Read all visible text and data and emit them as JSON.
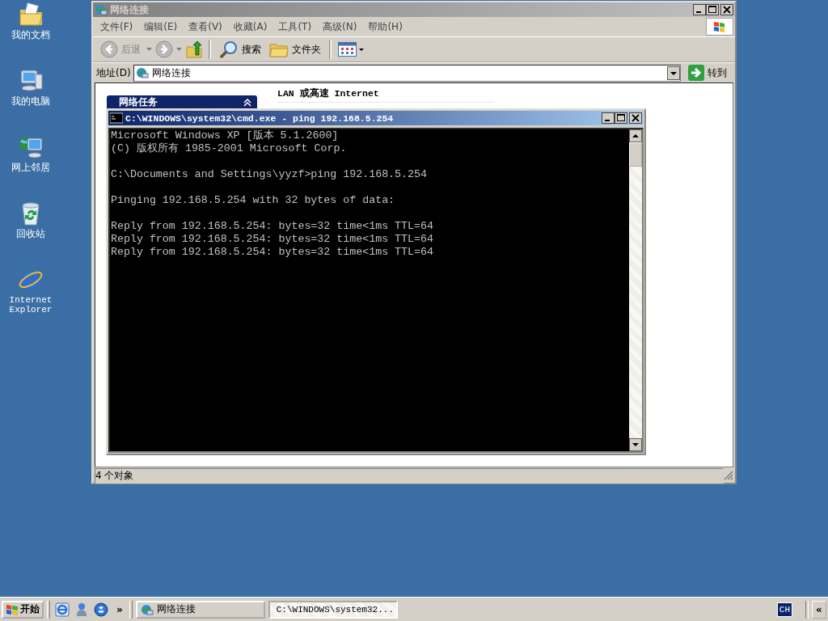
{
  "desktop_icons": [
    {
      "label": "我的文档",
      "kind": "documents"
    },
    {
      "label": "我的电脑",
      "kind": "computer"
    },
    {
      "label": "网上邻居",
      "kind": "network"
    },
    {
      "label": "回收站",
      "kind": "recycle"
    },
    {
      "label": "Internet Explorer",
      "kind": "browser"
    }
  ],
  "explorer": {
    "title": "网络连接",
    "active": false,
    "menu": [
      "文件(F)",
      "编辑(E)",
      "查看(V)",
      "收藏(A)",
      "工具(T)",
      "高级(N)",
      "帮助(H)"
    ],
    "toolbar": {
      "back": "后退",
      "search": "搜索",
      "folders": "文件夹"
    },
    "address": {
      "label": "地址(D)",
      "value": "网络连接",
      "go": "转到"
    },
    "task_panel": {
      "title": "网络任务"
    },
    "section_header": "LAN 或高速 Internet",
    "status_bar": "4 个对象"
  },
  "console": {
    "title": "C:\\WINDOWS\\system32\\cmd.exe - ping 192.168.5.254",
    "active": true,
    "paragraphs": [
      [
        "Microsoft Windows XP [版本 5.1.2600]",
        "(C) 版权所有 1985-2001 Microsoft Corp."
      ],
      [
        "C:\\Documents and Settings\\yyzf>ping 192.168.5.254"
      ],
      [
        "Pinging 192.168.5.254 with 32 bytes of data:"
      ],
      [
        "Reply from 192.168.5.254: bytes=32 time<1ms TTL=64",
        "Reply from 192.168.5.254: bytes=32 time<1ms TTL=64",
        "Reply from 192.168.5.254: bytes=32 time<1ms TTL=64"
      ]
    ]
  },
  "taskbar": {
    "start": "开始",
    "more": "»",
    "tasks": [
      {
        "label": "网络连接",
        "kind": "explorer",
        "selected": false
      },
      {
        "label": "C:\\WINDOWS\\system32...",
        "kind": "console",
        "selected": true
      }
    ],
    "language": "CH",
    "tray_toggle": "«"
  }
}
